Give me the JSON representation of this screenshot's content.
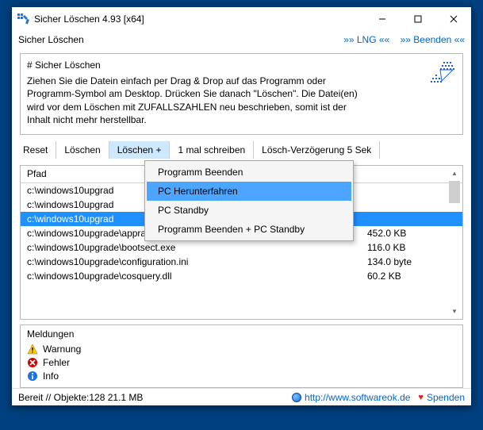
{
  "title": "Sicher Löschen 4.93 [x64]",
  "menubar": {
    "left": "Sicher Löschen",
    "lng": "»» LNG ««",
    "exit": "»» Beenden ««"
  },
  "infobox": {
    "title": "# Sicher Löschen",
    "text": "Ziehen Sie die Datein einfach per Drag & Drop auf das Programm oder Programm-Symbol am Desktop. Drücken Sie danach \"Löschen\". Die Datei(en) wird vor dem Löschen mit ZUFALLSZAHLEN neu beschrieben, somit ist der Inhalt nicht mehr herstellbar."
  },
  "toolbar": {
    "reset": "Reset",
    "delete": "Löschen",
    "delete_plus": "Löschen +",
    "write_once": "1 mal schreiben",
    "delay": "Lösch-Verzögerung 5 Sek"
  },
  "dropdown": {
    "items": [
      {
        "label": "Programm Beenden"
      },
      {
        "label": "PC Herunterfahren"
      },
      {
        "label": "PC Standby"
      },
      {
        "label": "Programm Beenden + PC Standby"
      }
    ],
    "highlight_index": 1
  },
  "table": {
    "header_path": "Pfad",
    "rows": [
      {
        "path": "c:\\windows10upgrad",
        "size": ""
      },
      {
        "path": "c:\\windows10upgrad",
        "size": ""
      },
      {
        "path": "c:\\windows10upgrad",
        "size": "",
        "selected": true
      },
      {
        "path": "c:\\windows10upgrade\\appraiserxp.dll",
        "size": "452.0 KB"
      },
      {
        "path": "c:\\windows10upgrade\\bootsect.exe",
        "size": "116.0 KB"
      },
      {
        "path": "c:\\windows10upgrade\\configuration.ini",
        "size": "134.0 byte"
      },
      {
        "path": "c:\\windows10upgrade\\cosquery.dll",
        "size": "60.2 KB"
      }
    ]
  },
  "messages": {
    "title": "Meldungen",
    "warning": "Warnung",
    "error": "Fehler",
    "info": "Info"
  },
  "statusbar": {
    "status": "Bereit // Objekte:128 21.1 MB",
    "url": "http://www.softwareok.de",
    "donate": "Spenden"
  }
}
